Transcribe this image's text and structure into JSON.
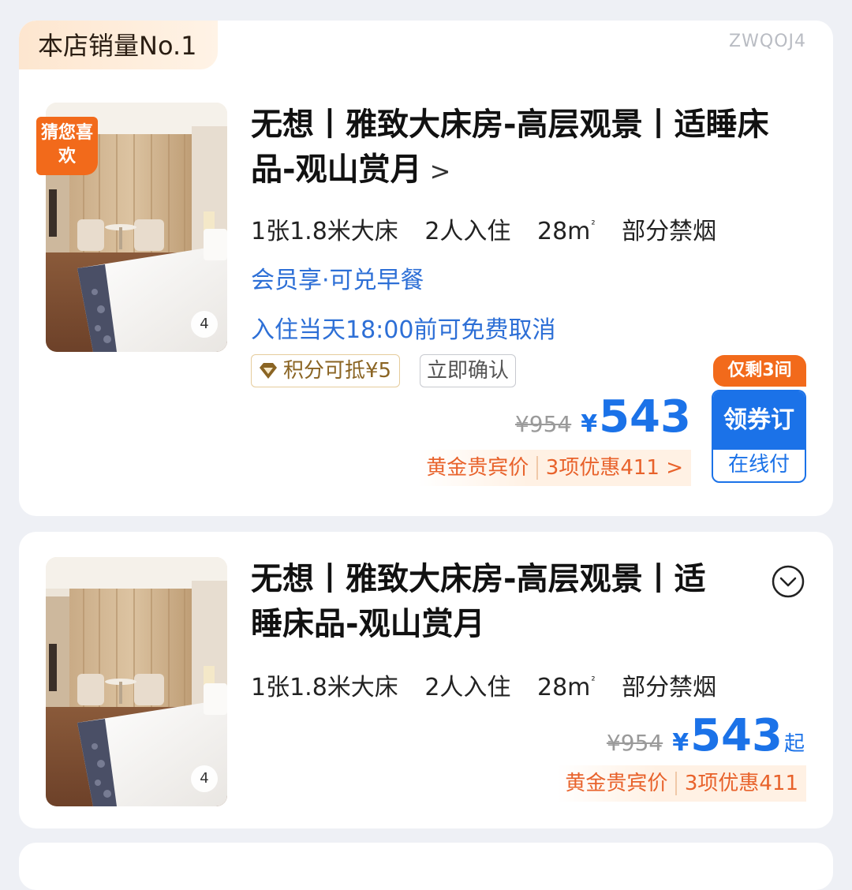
{
  "card1": {
    "sales_tag": "本店销量No.1",
    "room_code": "ZWQOJ4",
    "badge": "猜您喜欢",
    "image_count": "4",
    "title": "无想丨雅致大床房-高层观景丨适睡床品-观山赏月",
    "chevron": ">",
    "specs": {
      "bed": "1张1.8米大床",
      "guests": "2人入住",
      "area": "28m",
      "area_sup": "²",
      "smoking": "部分禁烟"
    },
    "benefit": "会员享·可兑早餐",
    "cancellation": "入住当天18:00前可免费取消",
    "tags": {
      "points": "积分可抵¥5",
      "confirm": "立即确认"
    },
    "remaining": "仅剩3间",
    "price": {
      "original": "¥954",
      "currency": "¥",
      "current": "543"
    },
    "discount": {
      "member": "黄金贵宾价",
      "offers": "3项优惠411 >"
    },
    "book_button": {
      "main": "领券订",
      "sub": "在线付"
    }
  },
  "card2": {
    "image_count": "4",
    "title": "无想丨雅致大床房-高层观景丨适睡床品-观山赏月",
    "specs": {
      "bed": "1张1.8米大床",
      "guests": "2人入住",
      "area": "28m",
      "area_sup": "²",
      "smoking": "部分禁烟"
    },
    "price": {
      "original": "¥954",
      "currency": "¥",
      "current": "543",
      "suffix": "起"
    },
    "discount": {
      "member": "黄金贵宾价",
      "offers": "3项优惠411"
    },
    "expand_icon": "chevron-down-circle-icon"
  },
  "colors": {
    "price_blue": "#1b72e8",
    "accent_orange": "#f26a1b",
    "benefit_blue": "#2d6fd6",
    "discount_orange": "#e8622b"
  }
}
